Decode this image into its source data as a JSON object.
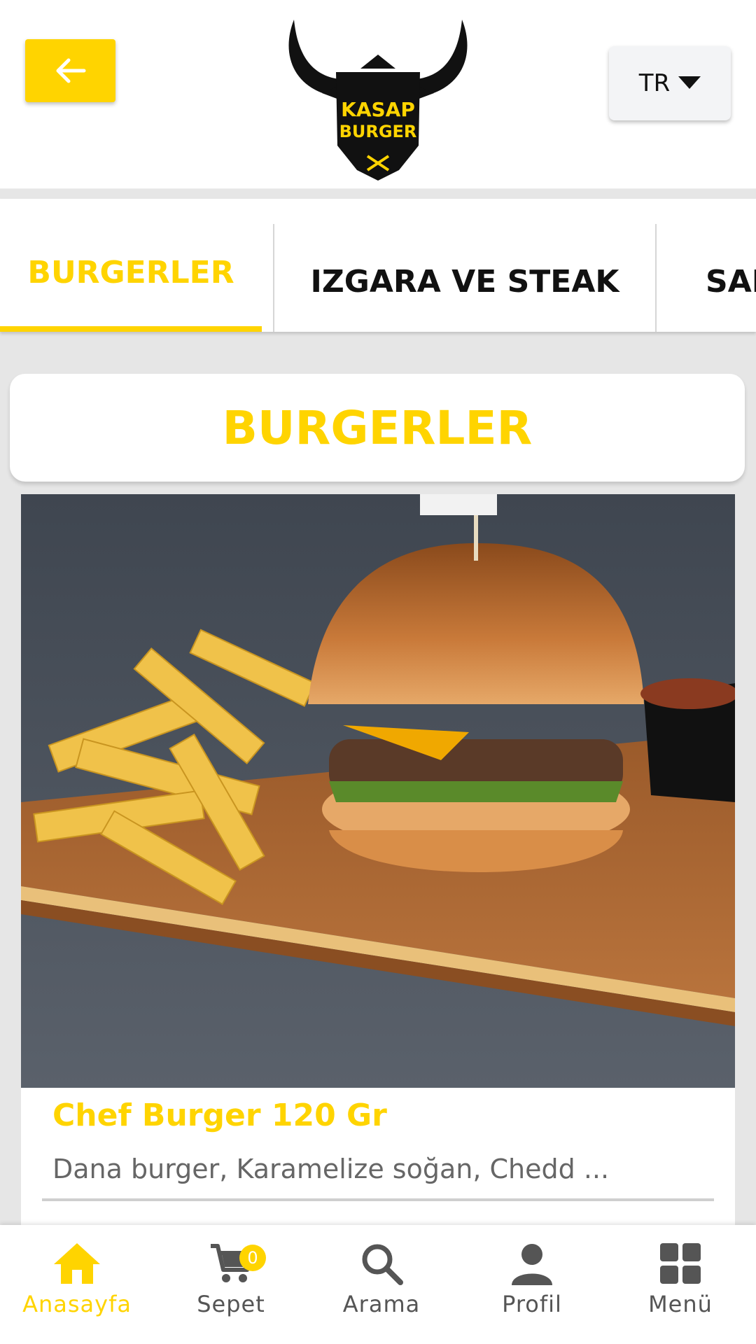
{
  "header": {
    "back_icon": "arrow-left-icon",
    "logo_text_top": "KASAP",
    "logo_text_bottom": "BURGER",
    "language": "TR"
  },
  "tabs": [
    {
      "label": "BURGERLER",
      "active": true
    },
    {
      "label": "IZGARA VE STEAK",
      "active": false
    },
    {
      "label": "SAL",
      "active": false
    }
  ],
  "section": {
    "title": "BURGERLER"
  },
  "product": {
    "name": "Chef Burger 120 Gr",
    "description": "Dana burger, Karamelize soğan, Chedd ..."
  },
  "bottom_nav": [
    {
      "label": "Anasayfa",
      "icon": "home-icon",
      "active": true
    },
    {
      "label": "Sepet",
      "icon": "cart-icon",
      "badge": "0"
    },
    {
      "label": "Arama",
      "icon": "search-icon"
    },
    {
      "label": "Profil",
      "icon": "user-icon"
    },
    {
      "label": "Menü",
      "icon": "grid-icon"
    }
  ],
  "colors": {
    "accent": "#ffd400",
    "text_dark": "#111111",
    "muted": "#666666"
  }
}
